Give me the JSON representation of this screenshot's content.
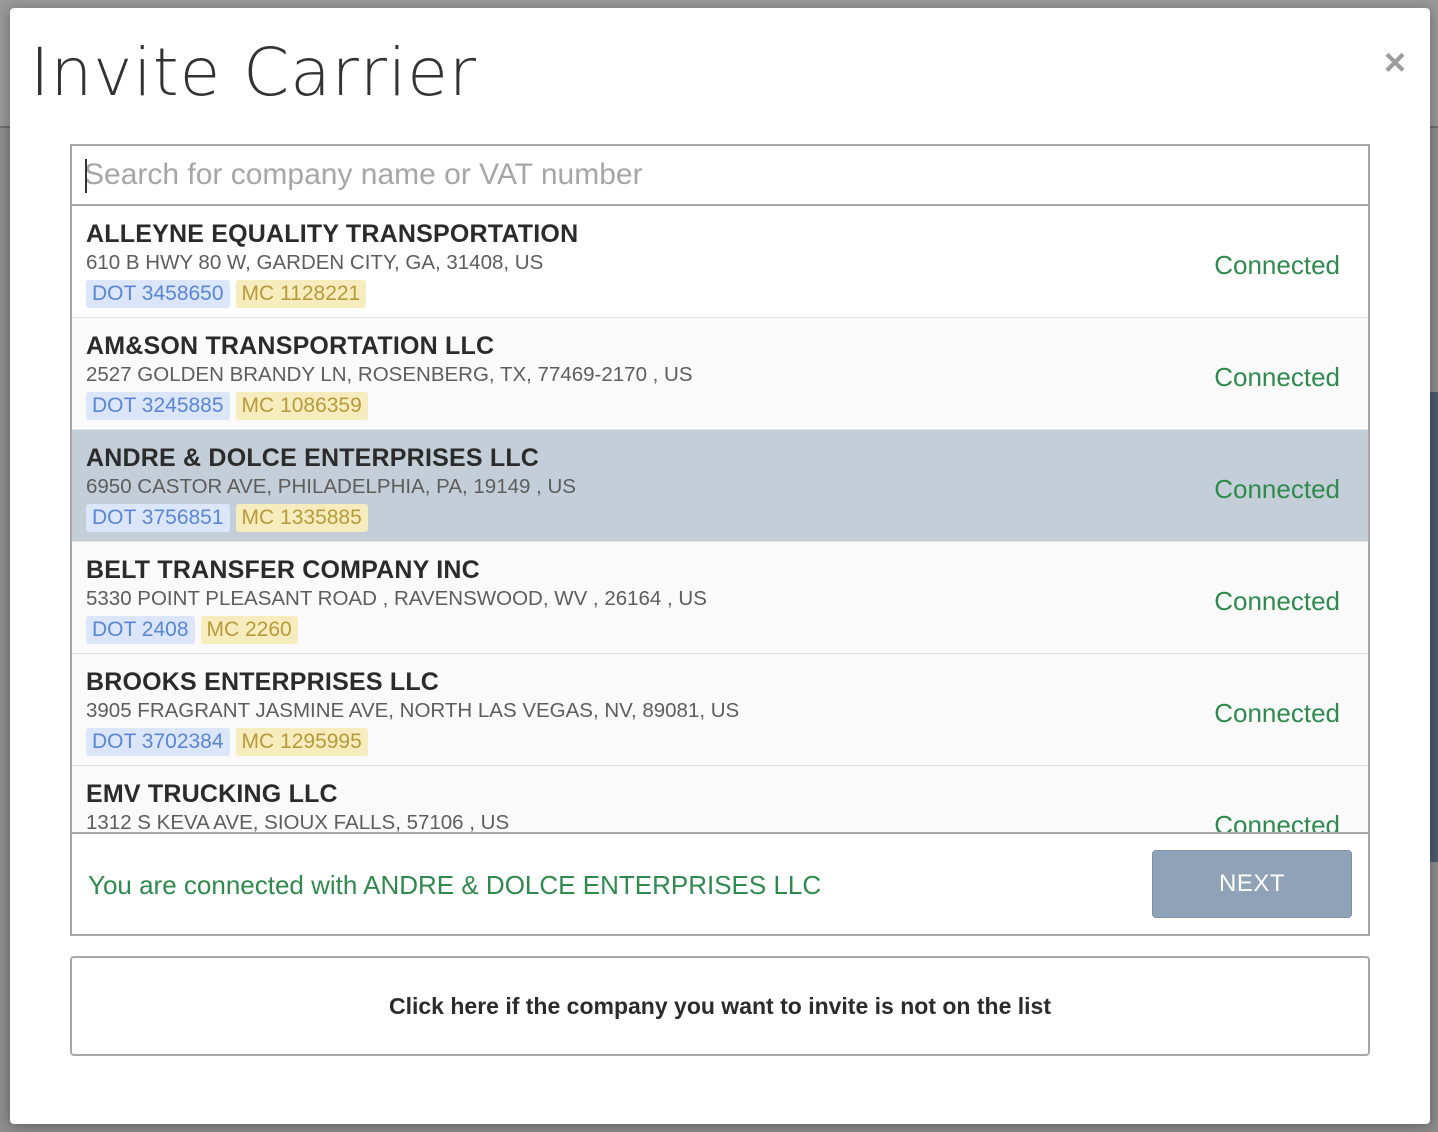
{
  "modal": {
    "title": "Invite Carrier",
    "close_label": "×"
  },
  "search": {
    "placeholder": "Search for company name or VAT number",
    "value": ""
  },
  "results": [
    {
      "name": "ALLEYNE EQUALITY TRANSPORTATION",
      "address": "610 B HWY 80 W, GARDEN CITY, GA, 31408, US",
      "dot": "DOT 3458650",
      "mc": "MC 1128221",
      "status": "Connected",
      "selected": false
    },
    {
      "name": "AM&SON TRANSPORTATION LLC",
      "address": "2527 GOLDEN BRANDY LN, ROSENBERG, TX, 77469-2170 , US",
      "dot": "DOT 3245885",
      "mc": "MC 1086359",
      "status": "Connected",
      "selected": false
    },
    {
      "name": "ANDRE & DOLCE ENTERPRISES LLC",
      "address": "6950 CASTOR AVE, PHILADELPHIA, PA, 19149 , US",
      "dot": "DOT 3756851",
      "mc": "MC 1335885",
      "status": "Connected",
      "selected": true
    },
    {
      "name": "BELT TRANSFER COMPANY INC",
      "address": "5330 POINT PLEASANT ROAD , RAVENSWOOD, WV , 26164 , US",
      "dot": "DOT 2408",
      "mc": "MC 2260",
      "status": "Connected",
      "selected": false
    },
    {
      "name": "BROOKS ENTERPRISES LLC",
      "address": "3905 FRAGRANT JASMINE AVE, NORTH LAS VEGAS, NV, 89081, US",
      "dot": "DOT 3702384",
      "mc": "MC 1295995",
      "status": "Connected",
      "selected": false
    },
    {
      "name": "EMV TRUCKING LLC",
      "address": "1312 S KEVA AVE, SIOUX FALLS, 57106 , US",
      "dot": "",
      "mc": "",
      "status": "Connected",
      "selected": false
    }
  ],
  "footer": {
    "message": "You are connected with ANDRE & DOLCE ENTERPRISES LLC",
    "next_label": "NEXT"
  },
  "not_listed_label": "Click here if the company you want to invite is not on the list",
  "colors": {
    "connected_green": "#2f8a4d",
    "selected_row": "#c3ced8",
    "next_button": "#8fa2b7",
    "dot_badge_bg": "#dbe6fa",
    "mc_badge_bg": "#f6ecbe"
  }
}
